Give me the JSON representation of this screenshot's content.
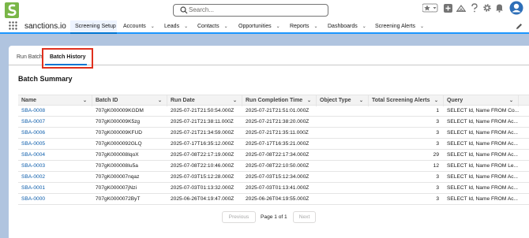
{
  "header": {
    "search_placeholder": "Search...",
    "icons": [
      "favorites-star-icon",
      "favorites-menu-icon",
      "add-icon",
      "trailhead-icon",
      "help-icon",
      "setup-gear-icon",
      "notifications-bell-icon",
      "user-avatar-icon"
    ]
  },
  "nav": {
    "app_name": "sanctions.io",
    "items": [
      {
        "label": "Screening Setup",
        "active": true
      },
      {
        "label": "Accounts"
      },
      {
        "label": "Leads"
      },
      {
        "label": "Contacts"
      },
      {
        "label": "Opportunities"
      },
      {
        "label": "Reports"
      },
      {
        "label": "Dashboards"
      },
      {
        "label": "Screening Alerts"
      }
    ]
  },
  "tabs": {
    "run_batch": "Run Batch",
    "batch_history": "Batch History"
  },
  "section_title": "Batch Summary",
  "table": {
    "columns": [
      "Name",
      "Batch ID",
      "Run Date",
      "Run Completion Time",
      "Object Type",
      "Total Screening Alerts",
      "Query"
    ],
    "rows": [
      {
        "name": "SBA-0008",
        "batch_id": "707gK000009KGDM",
        "run_date": "2025-07-21T21:50:54.000Z",
        "completion": "2025-07-21T21:51:01.000Z",
        "object_type": "",
        "alerts": "1",
        "query": "SELECT Id, Name FROM Co..."
      },
      {
        "name": "SBA-0007",
        "batch_id": "707gK000009K5zg",
        "run_date": "2025-07-21T21:38:11.000Z",
        "completion": "2025-07-21T21:38:20.000Z",
        "object_type": "",
        "alerts": "3",
        "query": "SELECT Id, Name FROM Ac..."
      },
      {
        "name": "SBA-0006",
        "batch_id": "707gK000009KFUD",
        "run_date": "2025-07-21T21:34:59.000Z",
        "completion": "2025-07-21T21:35:11.000Z",
        "object_type": "",
        "alerts": "3",
        "query": "SELECT Id, Name FROM Ac..."
      },
      {
        "name": "SBA-0005",
        "batch_id": "707gK0000092GLQ",
        "run_date": "2025-07-17T16:35:12.000Z",
        "completion": "2025-07-17T16:35:21.000Z",
        "object_type": "",
        "alerts": "3",
        "query": "SELECT Id, Name FROM Ac..."
      },
      {
        "name": "SBA-0004",
        "batch_id": "707gK000008IqoX",
        "run_date": "2025-07-08T22:17:19.000Z",
        "completion": "2025-07-08T22:17:34.000Z",
        "object_type": "",
        "alerts": "29",
        "query": "SELECT Id, Name FROM Ac..."
      },
      {
        "name": "SBA-0003",
        "batch_id": "707gK000008Iu5a",
        "run_date": "2025-07-08T22:10:46.000Z",
        "completion": "2025-07-08T22:10:50.000Z",
        "object_type": "",
        "alerts": "12",
        "query": "SELECT Id, Name FROM Le..."
      },
      {
        "name": "SBA-0002",
        "batch_id": "707gK000007nqaz",
        "run_date": "2025-07-03T15:12:28.000Z",
        "completion": "2025-07-03T15:12:34.000Z",
        "object_type": "",
        "alerts": "3",
        "query": "SELECT Id, Name FROM Ac..."
      },
      {
        "name": "SBA-0001",
        "batch_id": "707gK000007jNzi",
        "run_date": "2025-07-03T01:13:32.000Z",
        "completion": "2025-07-03T01:13:41.000Z",
        "object_type": "",
        "alerts": "3",
        "query": "SELECT Id, Name FROM Ac..."
      },
      {
        "name": "SBA-0000",
        "batch_id": "707gK0000072ByT",
        "run_date": "2025-06-26T04:19:47.000Z",
        "completion": "2025-06-26T04:19:55.000Z",
        "object_type": "",
        "alerts": "3",
        "query": "SELECT Id, Name FROM Ac..."
      }
    ]
  },
  "pagination": {
    "previous": "Previous",
    "info": "Page 1 of 1",
    "next": "Next"
  },
  "colors": {
    "accent": "#0176d3",
    "link": "#0b5cab",
    "highlight_box": "#e0301e",
    "background": "#b0c4df",
    "logo_green": "#7ab648"
  }
}
